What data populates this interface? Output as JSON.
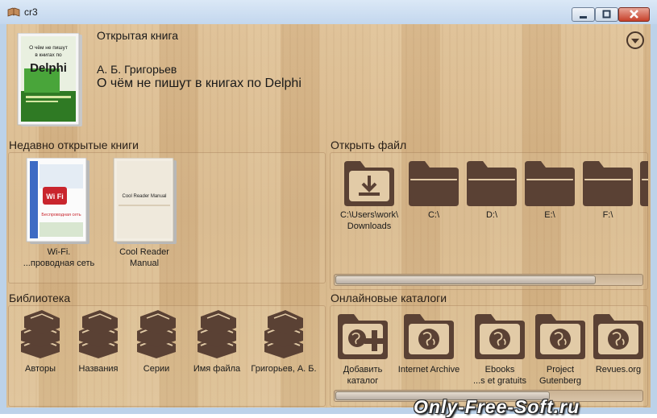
{
  "window": {
    "title": "cr3",
    "controls": {
      "minimize": "minimize",
      "maximize": "maximize",
      "close": "close"
    }
  },
  "current_book": {
    "header": "Открытая книга",
    "author": "А. Б. Григорьев",
    "title": "О чём не пишут в книгах по Delphi",
    "cover_text": {
      "line1": "О чём не пишут",
      "line2": "в книгах по",
      "line3": "Delphi"
    }
  },
  "recent": {
    "title": "Недавно открытые книги",
    "books": [
      {
        "line1": "Wi-Fi.",
        "line2": "...проводная сеть",
        "cover_main": "Wi Fi",
        "cover_sub": "Беспроводная сеть"
      },
      {
        "line1": "Cool Reader",
        "line2": "Manual",
        "cover_main": "Cool Reader Manual",
        "cover_sub": ""
      }
    ]
  },
  "open_file": {
    "title": "Открыть файл",
    "items": [
      {
        "line1": "C:\\Users\\work\\",
        "line2": "Downloads",
        "icon": "download-folder-icon"
      },
      {
        "line1": "C:\\",
        "line2": "",
        "icon": "folder-icon"
      },
      {
        "line1": "D:\\",
        "line2": "",
        "icon": "folder-icon"
      },
      {
        "line1": "E:\\",
        "line2": "",
        "icon": "folder-icon"
      },
      {
        "line1": "F:\\",
        "line2": "",
        "icon": "folder-icon"
      }
    ],
    "scroll_fraction": 0.85
  },
  "library": {
    "title": "Библиотека",
    "items": [
      {
        "label": "Авторы",
        "icon": "books-stack-icon"
      },
      {
        "label": "Названия",
        "icon": "books-stack-icon"
      },
      {
        "label": "Серии",
        "icon": "books-stack-icon"
      },
      {
        "label": "Имя файла",
        "icon": "books-stack-icon"
      },
      {
        "label": "Григорьев, А. Б.",
        "icon": "books-stack-icon"
      }
    ]
  },
  "catalogs": {
    "title": "Онлайновые каталоги",
    "items": [
      {
        "line1": "Добавить",
        "line2": "каталог",
        "icon": "add-catalog-icon"
      },
      {
        "line1": "Internet Archive",
        "line2": "",
        "icon": "globe-folder-icon"
      },
      {
        "line1": "Ebooks",
        "line2": "...s et gratuits",
        "icon": "globe-folder-icon"
      },
      {
        "line1": "Project",
        "line2": "Gutenberg",
        "icon": "globe-folder-icon"
      },
      {
        "line1": "Revues.org",
        "line2": "",
        "icon": "globe-folder-icon"
      }
    ],
    "scroll_fraction": 0.7
  },
  "watermark": "Only-Free-Soft.ru",
  "colors": {
    "icon_brown": "#5a4134",
    "wood": "#d6b487"
  }
}
